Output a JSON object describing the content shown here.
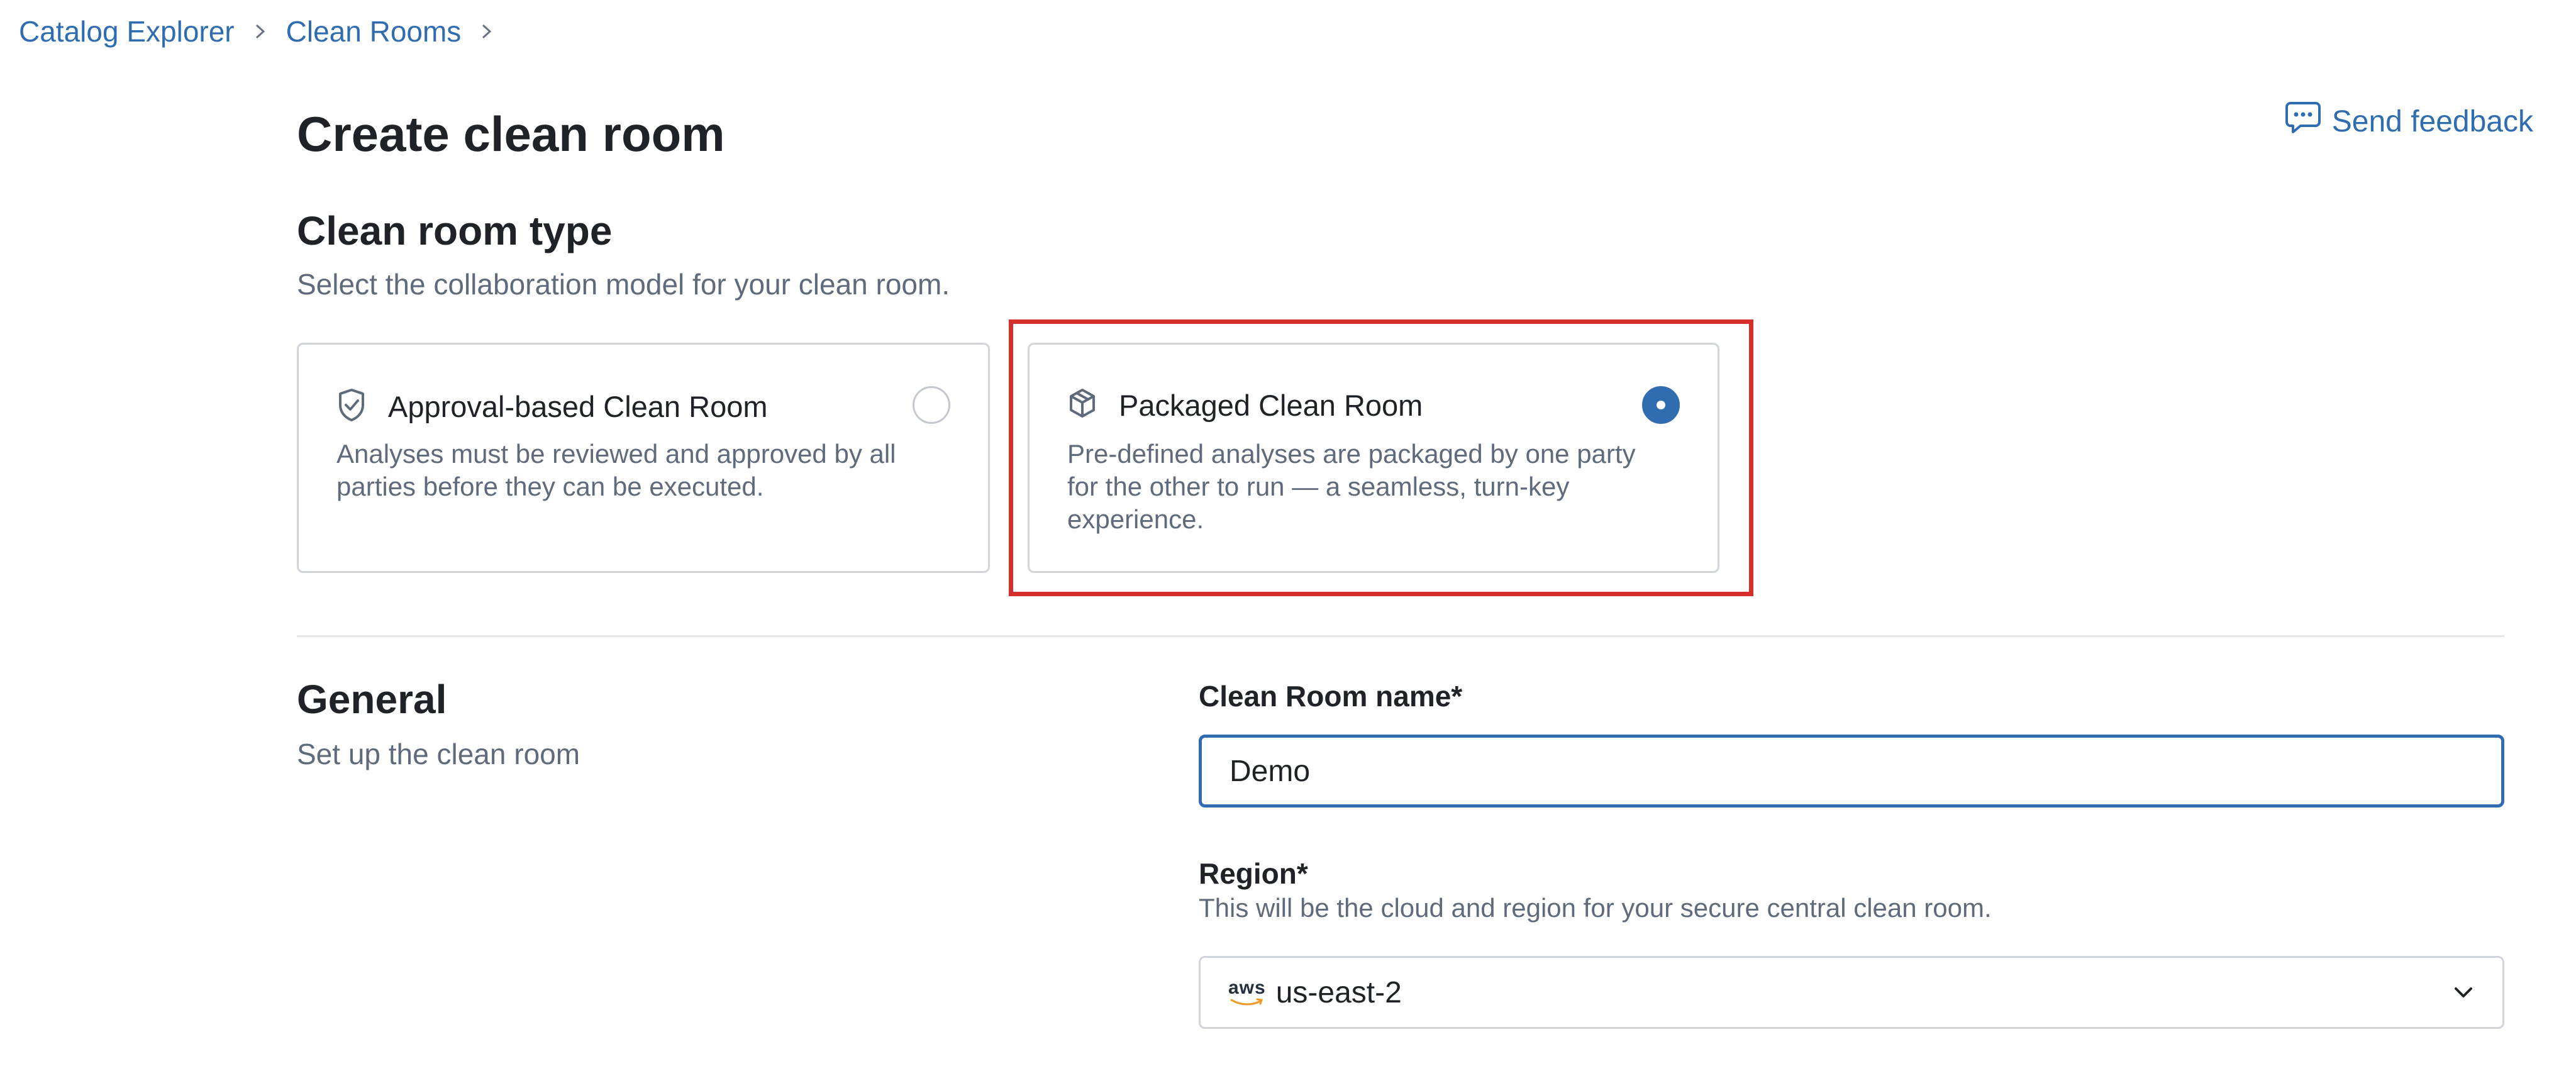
{
  "breadcrumb": {
    "items": [
      {
        "label": "Catalog Explorer"
      },
      {
        "label": "Clean Rooms"
      }
    ]
  },
  "feedback": {
    "label": "Send feedback"
  },
  "page_title": "Create clean room",
  "clean_room_type": {
    "title": "Clean room type",
    "subtitle": "Select the collaboration model for your clean room.",
    "options": [
      {
        "title": "Approval-based Clean Room",
        "description": "Analyses must be reviewed and approved by all parties before they can be executed.",
        "icon": "shield-check-icon",
        "selected": false
      },
      {
        "title": "Packaged Clean Room",
        "description": "Pre-defined analyses are packaged by one party for the other to run — a seamless, turn-key experience.",
        "icon": "package-icon",
        "selected": true
      }
    ]
  },
  "general": {
    "title": "General",
    "subtitle": "Set up the clean room",
    "name_field": {
      "label": "Clean Room name*",
      "value": "Demo"
    },
    "region_field": {
      "label": "Region*",
      "help": "This will be the cloud and region for your secure central clean room.",
      "provider_logo_text": "aws",
      "value": "us-east-2"
    }
  },
  "colors": {
    "link": "#2f6db0",
    "accent": "#2f6db0",
    "highlight": "#d62f2a",
    "muted_text": "#5f6b7a"
  }
}
